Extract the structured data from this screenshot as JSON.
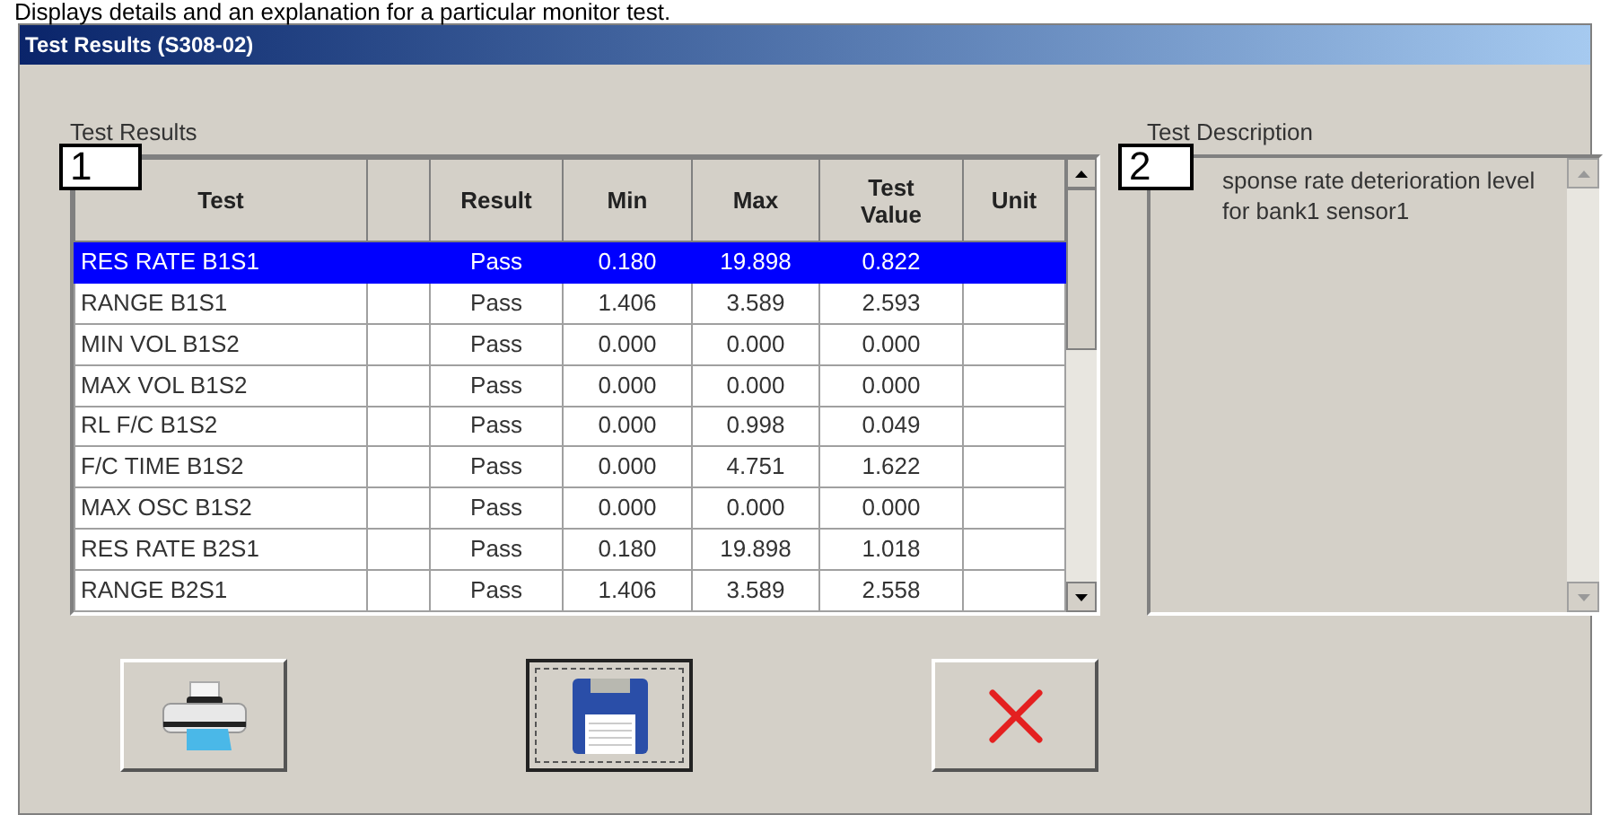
{
  "caption": "Displays details and an explanation for a particular monitor test.",
  "window": {
    "title": "Test Results (S308-02)"
  },
  "results_label": "Test Results",
  "callouts": [
    "1",
    "2"
  ],
  "table": {
    "columns": [
      "Test",
      "",
      "Result",
      "Min",
      "Max",
      "Test Value",
      "Unit"
    ],
    "rows": [
      {
        "cells": [
          "RES RATE B1S1",
          "",
          "Pass",
          "0.180",
          "19.898",
          "0.822",
          ""
        ],
        "selected": true
      },
      {
        "cells": [
          "RANGE B1S1",
          "",
          "Pass",
          "1.406",
          "3.589",
          "2.593",
          ""
        ],
        "selected": false
      },
      {
        "cells": [
          "MIN VOL B1S2",
          "",
          "Pass",
          "0.000",
          "0.000",
          "0.000",
          ""
        ],
        "selected": false
      },
      {
        "cells": [
          "MAX VOL B1S2",
          "",
          "Pass",
          "0.000",
          "0.000",
          "0.000",
          ""
        ],
        "selected": false
      },
      {
        "cells": [
          "RL F/C B1S2",
          "",
          "Pass",
          "0.000",
          "0.998",
          "0.049",
          ""
        ],
        "selected": false
      },
      {
        "cells": [
          "F/C TIME B1S2",
          "",
          "Pass",
          "0.000",
          "4.751",
          "1.622",
          ""
        ],
        "selected": false
      },
      {
        "cells": [
          "MAX OSC B1S2",
          "",
          "Pass",
          "0.000",
          "0.000",
          "0.000",
          ""
        ],
        "selected": false
      },
      {
        "cells": [
          "RES RATE B2S1",
          "",
          "Pass",
          "0.180",
          "19.898",
          "1.018",
          ""
        ],
        "selected": false
      },
      {
        "cells": [
          "RANGE B2S1",
          "",
          "Pass",
          "1.406",
          "3.589",
          "2.558",
          ""
        ],
        "selected": false
      }
    ]
  },
  "description": {
    "label": "Test Description",
    "text": "sponse rate deterioration level for bank1 sensor1"
  },
  "buttons": [
    {
      "kind": "print",
      "focused": false
    },
    {
      "kind": "save",
      "focused": true
    },
    {
      "kind": "close",
      "focused": false
    }
  ]
}
